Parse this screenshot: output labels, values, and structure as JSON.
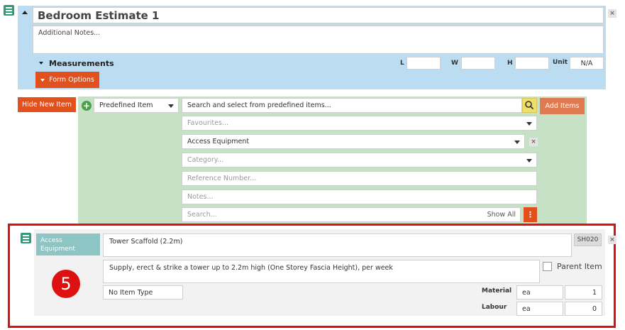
{
  "estimate": {
    "title": "Bedroom Estimate 1",
    "notes_placeholder": "Additional Notes...",
    "measurements_label": "Measurements",
    "l_label": "L",
    "w_label": "W",
    "h_label": "H",
    "unit_label": "Unit",
    "unit_value": "N/A",
    "form_options_label": "Form Options"
  },
  "new_item": {
    "hide_button_label": "Hide New Item",
    "type_select": "Predefined Item",
    "search_placeholder": "Search and select from predefined items...",
    "add_items_label": "Add Items",
    "favourites_placeholder": "Favourites...",
    "group_value": "Access Equipment",
    "category_placeholder": "Category...",
    "reference_placeholder": "Reference Number...",
    "notes_placeholder": "Notes...",
    "search2_placeholder": "Search...",
    "show_all_label": "Show All"
  },
  "item": {
    "group_tag": "Access Equipment",
    "name": "Tower Scaffold (2.2m)",
    "code": "SH020",
    "description": "Supply, erect & strike a tower up to 2.2m high (One Storey Fascia Height), per week",
    "parent_item_label": "Parent Item",
    "item_type": "No Item Type",
    "step_number": "5",
    "material_label": "Material",
    "material_unit": "ea",
    "material_qty": "1",
    "labour_label": "Labour",
    "labour_unit": "ea",
    "labour_qty": "0"
  },
  "colors": {
    "header_bg": "#bcdcf1",
    "form_bg": "#c6e1c6",
    "accent_orange": "#e2501e",
    "add_items": "#e07a50",
    "menu_green": "#2e9c74",
    "tag_teal": "#8cc5c4",
    "highlight_red": "#dd1111",
    "search_yellow": "#f0de6c"
  }
}
